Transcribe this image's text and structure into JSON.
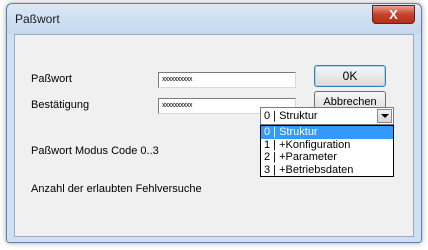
{
  "window": {
    "title": "Paßwort",
    "close_glyph": "X"
  },
  "form": {
    "password_label": "Paßwort",
    "password_value": "xxxxxxxxxx",
    "confirm_label": "Bestätigung",
    "confirm_value": "xxxxxxxxxx",
    "mode_label": "Paßwort Modus Code 0..3",
    "attempts_label": "Anzahl der erlaubten Fehlversuche"
  },
  "buttons": {
    "ok": "0K",
    "cancel": "Abbrechen"
  },
  "mode_combo": {
    "selected": "0 | Struktur",
    "options": [
      "0 | Struktur",
      "1 | +Konfiguration",
      "2 | +Parameter",
      "3 | +Betriebsdaten"
    ],
    "highlight_color": "#3399ff"
  }
}
